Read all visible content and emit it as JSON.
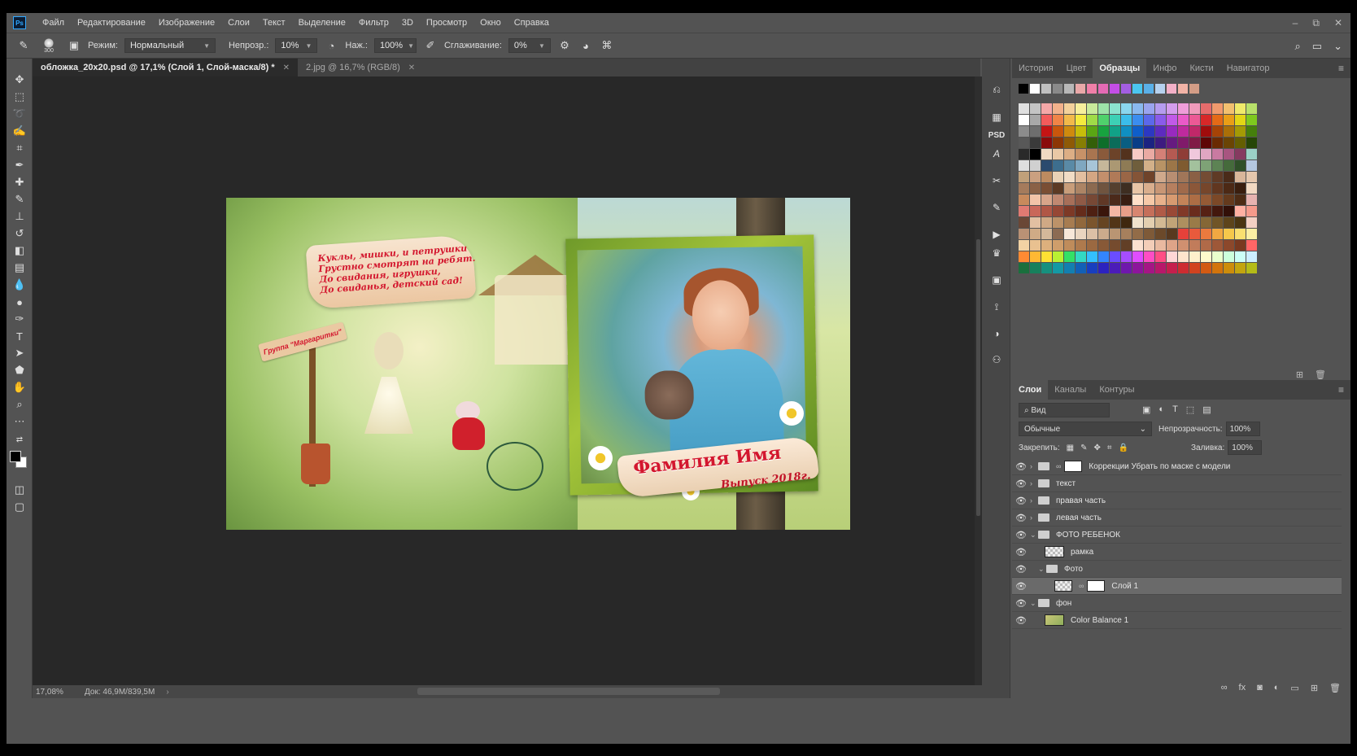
{
  "menu": {
    "logo": "Ps",
    "items": [
      "Файл",
      "Редактирование",
      "Изображение",
      "Слои",
      "Текст",
      "Выделение",
      "Фильтр",
      "3D",
      "Просмотр",
      "Окно",
      "Справка"
    ],
    "window_controls": [
      "–",
      "⧉",
      "✕"
    ]
  },
  "options": {
    "brush_size": "300",
    "mode_label": "Режим:",
    "mode_value": "Нормальный",
    "opacity_label": "Непрозр.:",
    "opacity_value": "10%",
    "flow_label": "Наж.:",
    "flow_value": "100%",
    "smoothing_label": "Сглаживание:",
    "smoothing_value": "0%"
  },
  "tabs": [
    {
      "label": "обложка_20x20.psd @ 17,1% (Слой 1, Слой-маска/8) *",
      "close": "✕"
    },
    {
      "label": "2.jpg @ 16,7% (RGB/8)",
      "close": "✕"
    }
  ],
  "status": {
    "zoom": "17,08%",
    "doc": "Док: 46,9M/839,5M",
    "arrow": "›"
  },
  "artwork": {
    "banner_lines": [
      "Куклы, мишки, и петрушки",
      "Грустно смотрят на ребят.",
      "До свидания, игрушки,",
      "До свиданья, детский сад!"
    ],
    "sign_text": "Группа \"Маргаритки\"",
    "ribbon_title": "Фамилия Имя",
    "ribbon_sub": "Выпуск 2018г."
  },
  "right_strip_icons": [
    "history-panel-icon",
    "psd-icon",
    "character-icon",
    "paragraph-icon",
    "tools-icon",
    "brush-settings-icon",
    "play-icon",
    "crown-icon",
    "image-icon",
    "clone-icon",
    "adjustment-icon",
    "channel-icon"
  ],
  "top_panel": {
    "tabs": [
      "История",
      "Цвет",
      "Образцы",
      "Инфо",
      "Кисти",
      "Навигатор"
    ],
    "active_tab": "Образцы",
    "recent_swatches": [
      "#000000",
      "#ffffff",
      "#c0c0c0",
      "#8a8a8a",
      "#b8b8b8",
      "#e9a8a8",
      "#f07fa8",
      "#e46ab4",
      "#c34ee6",
      "#a35ee2",
      "#4bc6f0",
      "#5ab0e8",
      "#b6d1ee",
      "#f3b0c7",
      "#f2b3a6",
      "#d39d86"
    ],
    "swatches": [
      "#e0e0e0",
      "#c4c4c4",
      "#f5a8a8",
      "#f2b18b",
      "#f3d19b",
      "#f6ef9c",
      "#c9ea9b",
      "#9de2a9",
      "#8be3cf",
      "#8ad6ee",
      "#8ab9ef",
      "#9aa4ef",
      "#b59cef",
      "#d39ded",
      "#ef9dd9",
      "#f09bbb",
      "#e66c6c",
      "#f19a6d",
      "#f2c06f",
      "#efea6a",
      "#b8e16a",
      "#ffffff",
      "#a8a8a8",
      "#f25b5b",
      "#f08447",
      "#f2b94a",
      "#f5ea3f",
      "#9fdb48",
      "#4fd16c",
      "#3dd0b5",
      "#3bbdea",
      "#3b8def",
      "#5c68ea",
      "#8a5bea",
      "#c15ae8",
      "#ea5ac8",
      "#ec5995",
      "#d72828",
      "#e46a17",
      "#e99e17",
      "#e2d615",
      "#7ec91e",
      "#8c8c8c",
      "#6e6e6e",
      "#c41414",
      "#c9560c",
      "#cf8a0e",
      "#c7bd0a",
      "#5aa614",
      "#17a33f",
      "#11a287",
      "#0f8fc2",
      "#0f5ec9",
      "#2c38c2",
      "#5d2bbf",
      "#982abf",
      "#bf2a9e",
      "#c02869",
      "#a00c0c",
      "#a64306",
      "#aa6f08",
      "#a49a05",
      "#457f0c",
      "#585858",
      "#3a3a3a",
      "#8a0a0a",
      "#8c3604",
      "#8e5a06",
      "#867e03",
      "#345f09",
      "#0e6e2a",
      "#0b6c5a",
      "#095e82",
      "#093d87",
      "#1b2381",
      "#3d1b80",
      "#661b80",
      "#801b6a",
      "#801a46",
      "#5e0606",
      "#6a2a03",
      "#6a4404",
      "#645e02",
      "#264606",
      "#2a2a2a",
      "#000000",
      "#f0d9c2",
      "#e9c8a6",
      "#dcae85",
      "#c79268",
      "#a97550",
      "#8a5a3b",
      "#6c4329",
      "#53321d",
      "#f7c9c4",
      "#eaaaa3",
      "#d48077",
      "#b55a52",
      "#8f3d37",
      "#f0c8dc",
      "#e0a6c2",
      "#c97aa1",
      "#a85580",
      "#863a60",
      "#9bd1c6",
      "#dedede",
      "#d0d0d0",
      "#2b4a6e",
      "#3d6e8e",
      "#5a8aa6",
      "#7fa7c0",
      "#a7c5d8",
      "#c6b79a",
      "#ab9873",
      "#8e7b55",
      "#6f5e3c",
      "#d2b089",
      "#b89365",
      "#9c7648",
      "#7f5b30",
      "#a3c19d",
      "#7ea276",
      "#5d8354",
      "#456a3b",
      "#2f4f28",
      "#b4c7e0",
      "#c0a07a",
      "#caa080",
      "#bd8b60",
      "#e9d2b6",
      "#f1dcc5",
      "#e3bfa0",
      "#d4a683",
      "#c38f6c",
      "#b07a58",
      "#9a6646",
      "#845437",
      "#6f432a",
      "#cfa98c",
      "#b88e72",
      "#a07659",
      "#8a6045",
      "#744c34",
      "#5f3a25",
      "#4a2b19",
      "#d9b69a",
      "#e5c7ad",
      "#a57b5c",
      "#8a6146",
      "#7a4e33",
      "#5c3a24",
      "#c89d7a",
      "#ac8465",
      "#8c6a50",
      "#70543f",
      "#55402f",
      "#3e2e21",
      "#e8c5a6",
      "#d9ae8d",
      "#c89675",
      "#b67f5f",
      "#a06a4b",
      "#8b5739",
      "#76462b",
      "#61361f",
      "#4c2915",
      "#3a1e0e",
      "#f2d9c2",
      "#c88a5c",
      "#f2c4a8",
      "#d8a58a",
      "#c08871",
      "#a76f59",
      "#8f5a46",
      "#774835",
      "#603826",
      "#4b2a1b",
      "#381e12",
      "#ffe0c8",
      "#f6c9a8",
      "#e8b18b",
      "#d79a70",
      "#c38359",
      "#ad6d45",
      "#955a35",
      "#7c4827",
      "#643a1d",
      "#4d2c15",
      "#e7b3b0",
      "#e07a72",
      "#c9685a",
      "#b05746",
      "#964735",
      "#7d3926",
      "#652c1b",
      "#4e2012",
      "#3a160b",
      "#f4b6a4",
      "#e79e89",
      "#d78670",
      "#c56f5a",
      "#b05b47",
      "#994936",
      "#813928",
      "#6a2c1d",
      "#562114",
      "#43170d",
      "#321008",
      "#ffb0a2",
      "#f59a8b",
      "#6a4736",
      "#e2c0a2",
      "#d0a985",
      "#bc9269",
      "#a77c51",
      "#91683d",
      "#7b552d",
      "#664421",
      "#523417",
      "#3f270f",
      "#f0e2cc",
      "#e3cfb0",
      "#d3ba94",
      "#c1a478",
      "#ae8f5f",
      "#9a7b48",
      "#856736",
      "#705527",
      "#5d441b",
      "#4a3512",
      "#f3d0c3",
      "#b99175",
      "#cfab86",
      "#d4b89a",
      "#8c6b53",
      "#f7e7d9",
      "#ead5c0",
      "#dbc0a6",
      "#cbab8c",
      "#b99573",
      "#a6805d",
      "#926c48",
      "#7e5a38",
      "#6b492a",
      "#58391f",
      "#e6413a",
      "#e85a3c",
      "#ea7a3e",
      "#f0a842",
      "#f5c84b",
      "#f9df70",
      "#fbeea3",
      "#f2d2a4",
      "#e9c190",
      "#ddb07d",
      "#cf9e6b",
      "#bf8c5b",
      "#ae7a4d",
      "#9b6941",
      "#885937",
      "#754b2e",
      "#623f26",
      "#fbe0d0",
      "#f3cdb8",
      "#e9b9a0",
      "#dea488",
      "#d09070",
      "#c17c5b",
      "#b06a48",
      "#9e5838",
      "#8c482b",
      "#793920",
      "#ff6666",
      "#ff8a33",
      "#ffb833",
      "#ffe033",
      "#b9f033",
      "#33e066",
      "#33d9c4",
      "#33bfff",
      "#3385ff",
      "#6a4dff",
      "#a64dff",
      "#e04dff",
      "#ff4dc4",
      "#ff4d85",
      "#ffd6d6",
      "#ffe4cc",
      "#fff0cc",
      "#fffacc",
      "#eaffcc",
      "#ccffdb",
      "#ccfff6",
      "#cceeff",
      "#1a6f3d",
      "#17805c",
      "#16907e",
      "#1499a4",
      "#137fb0",
      "#1260b6",
      "#183ebf",
      "#2c22bf",
      "#4b1cb9",
      "#6f18ad",
      "#8d159c",
      "#a51685",
      "#b8186a",
      "#c51f4d",
      "#cd2c31",
      "#d14320",
      "#d35b13",
      "#d2740c",
      "#cd8d0b",
      "#c3a50f",
      "#b4bb18"
    ]
  },
  "layers_panel": {
    "tabs": [
      "Слои",
      "Каналы",
      "Контуры"
    ],
    "active_tab": "Слои",
    "filter_placeholder": "Вид",
    "blend_mode": "Обычные",
    "opacity_label": "Непрозрачность:",
    "opacity_value": "100%",
    "lock_label": "Закрепить:",
    "fill_label": "Заливка:",
    "fill_value": "100%",
    "layers": [
      {
        "name": "Коррекции Убрать по маске с модели",
        "type": "group-mask",
        "indent": 0,
        "expanded": false
      },
      {
        "name": "текст",
        "type": "group",
        "indent": 0,
        "expanded": false
      },
      {
        "name": "правая часть",
        "type": "group",
        "indent": 0,
        "expanded": false
      },
      {
        "name": "левая часть",
        "type": "group",
        "indent": 0,
        "expanded": false
      },
      {
        "name": "ФОТО РЕБЕНОК",
        "type": "group",
        "indent": 0,
        "expanded": true
      },
      {
        "name": "рамка",
        "type": "layer-transparent",
        "indent": 1,
        "expanded": false
      },
      {
        "name": "Фото",
        "type": "group",
        "indent": 1,
        "expanded": true
      },
      {
        "name": "Слой 1",
        "type": "layer-mask",
        "indent": 2,
        "selected": true
      },
      {
        "name": "фон",
        "type": "group",
        "indent": 0,
        "expanded": true
      },
      {
        "name": "Color Balance 1",
        "type": "layer-image",
        "indent": 1,
        "expanded": false
      }
    ]
  }
}
